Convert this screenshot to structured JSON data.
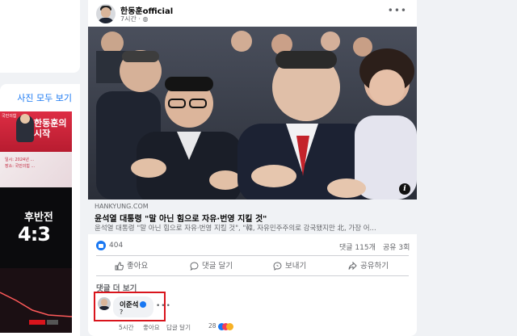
{
  "sidebar": {
    "photos_link": "사진 모두 보기",
    "thumb1": {
      "tag": "국민의힘",
      "title_line1": "한동훈의",
      "title_line2": "시작",
      "lines": [
        "일시: 2024년 ...",
        "장소: 국민의힘 ..."
      ]
    },
    "thumb2": {
      "title_line1": "후반전",
      "title_line2": "4:3"
    }
  },
  "post": {
    "author": "한동훈official",
    "time": "7시간 ·",
    "more_icon": "more-dots-icon",
    "link": {
      "domain": "HANKYUNG.COM",
      "headline": "윤석열 대통령 \"말 아닌 힘으로 자유·번영 지킬 것\"",
      "description": "윤석열 대통령 \"말 아닌 힘으로 자유·번영 지킬 것\", \"韓, 자유민주주의로 강국됐지만 北, 가장 어..."
    },
    "stats": {
      "likes": "404",
      "comments": "댓글 115개",
      "shares": "공유 3회"
    },
    "actions": {
      "like": "좋아요",
      "comment": "댓글 달기",
      "send": "보내기",
      "share": "공유하기"
    },
    "more_comments": "댓글 더 보기",
    "comment": {
      "name": "이준석",
      "text": "?",
      "time": "5시간",
      "like": "좋아요",
      "reply": "답글 달기",
      "reactions": "28"
    }
  },
  "colors": {
    "accent": "#1877f2",
    "highlight": "#d9141c",
    "background": "#f0f2f5"
  }
}
